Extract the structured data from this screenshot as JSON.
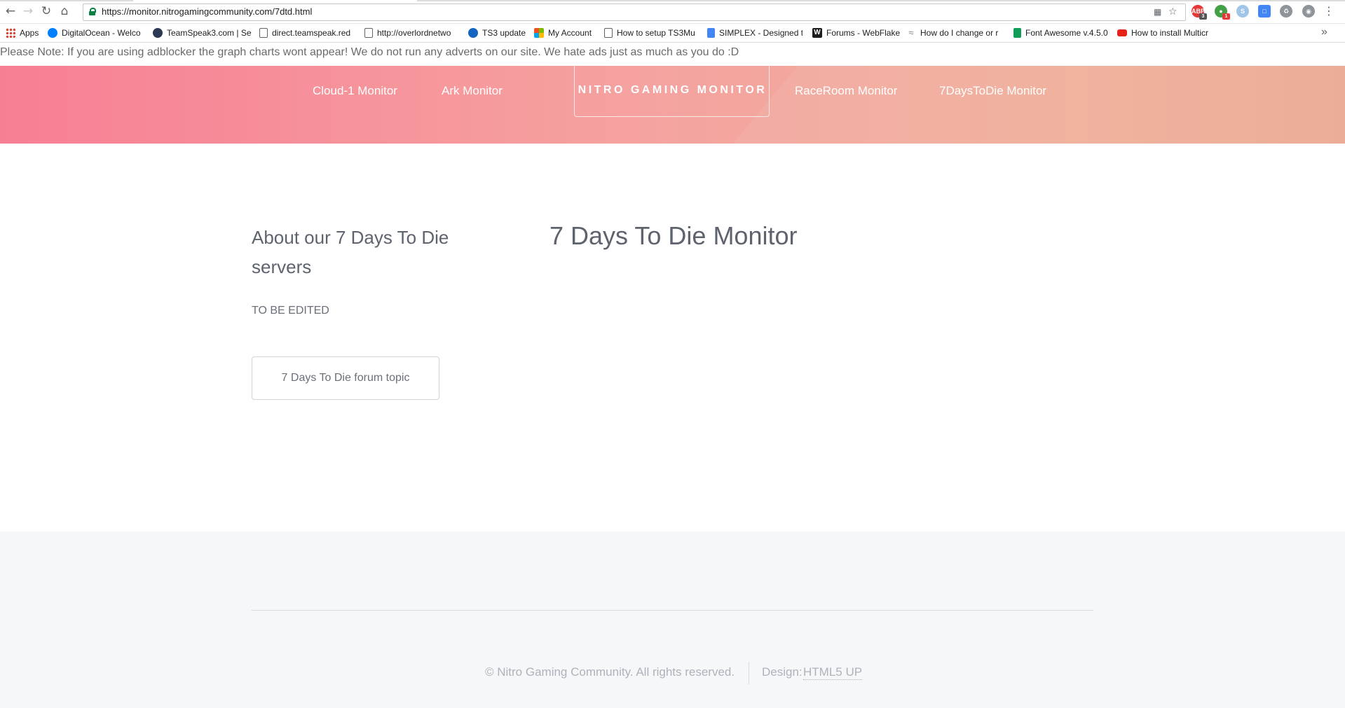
{
  "browser": {
    "url": "https://monitor.nitrogamingcommunity.com/7dtd.html",
    "icons": {
      "back": "back-arrow-icon",
      "forward": "forward-arrow-icon",
      "reload": "reload-icon",
      "home": "home-icon",
      "secure": "lock-icon",
      "star": "star-icon",
      "menu": "kebab-menu-icon"
    },
    "extensions": [
      {
        "name": "adblock-extension-icon",
        "badge": "3",
        "color": "#e53935"
      },
      {
        "name": "green-extension-icon",
        "badge": "1",
        "color": "#43a047"
      },
      {
        "name": "skype-extension-icon",
        "badge": "",
        "color": "#9fc6e8"
      },
      {
        "name": "cast-extension-icon",
        "badge": "",
        "color": "#4285f4"
      },
      {
        "name": "recycle-extension-icon",
        "badge": "",
        "color": "#8f9499"
      },
      {
        "name": "eye-extension-icon",
        "badge": "",
        "color": "#8f9499"
      }
    ],
    "bookmarks": [
      {
        "label": "Apps",
        "icon": "apps-grid-icon",
        "color": "#4285f4"
      },
      {
        "label": "DigitalOcean - Welco",
        "icon": "digitalocean-icon",
        "color": "#0080ff"
      },
      {
        "label": "TeamSpeak3.com | Se",
        "icon": "teamspeak-icon",
        "color": "#2b3a52"
      },
      {
        "label": "direct.teamspeak.red",
        "icon": "page-icon",
        "color": "#ffffff"
      },
      {
        "label": "http://overlordnetwo",
        "icon": "page-icon",
        "color": "#ffffff"
      },
      {
        "label": "TS3 update",
        "icon": "ts3-update-icon",
        "color": "#1565c0"
      },
      {
        "label": "My Account",
        "icon": "microsoft-icon",
        "color": "#f25022"
      },
      {
        "label": "How to setup TS3Mu",
        "icon": "page-icon",
        "color": "#ffffff"
      },
      {
        "label": "SIMPLEX - Designed t",
        "icon": "docs-icon",
        "color": "#4285f4"
      },
      {
        "label": "Forums - WebFlake",
        "icon": "webflake-icon",
        "color": "#1d1d1d"
      },
      {
        "label": "How do I change or r",
        "icon": "wifi-icon",
        "color": "#7a8794"
      },
      {
        "label": "Font Awesome v.4.5.0",
        "icon": "sheet-icon",
        "color": "#0f9d58"
      },
      {
        "label": "How to install Multicr",
        "icon": "youtube-icon",
        "color": "#e62117"
      }
    ],
    "more_bookmarks": "»"
  },
  "page": {
    "notice": "Please Note: If you are using adblocker the graph charts wont appear! We do not run any adverts on our site. We hate ads just as much as you do :D",
    "nav": {
      "links": [
        "Cloud-1 Monitor",
        "Ark Monitor",
        "RaceRoom Monitor",
        "7DaysToDie Monitor"
      ],
      "logo": "NITRO GAMING MONITOR"
    },
    "sidebar": {
      "title": "About our 7 Days To Die servers",
      "text": "TO BE EDITED",
      "button": "7 Days To Die forum topic"
    },
    "main": {
      "title": "7 Days To Die Monitor"
    },
    "footer": {
      "copyright": "© Nitro Gaming Community. All rights reserved.",
      "design_label": "Design:",
      "design_link": "HTML5 UP"
    },
    "colors": {
      "header_gradient_start": "#f77f94",
      "header_gradient_end": "#eba791",
      "footer_bg": "#f6f7f9"
    }
  }
}
